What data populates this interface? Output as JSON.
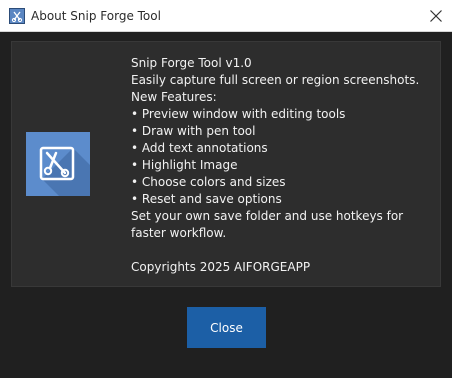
{
  "window": {
    "title": "About Snip Forge Tool"
  },
  "about": {
    "heading": "Snip Forge Tool v1.0",
    "description": "Easily capture full screen or region screenshots.",
    "features_label": "New Features:",
    "features": [
      "• Preview window with editing tools",
      "• Draw with pen tool",
      "• Add text annotations",
      "• Highlight Image",
      "• Choose colors and sizes",
      "• Reset and save options"
    ],
    "note": "Set your own save folder and use hotkeys for faster workflow.",
    "copyright": "Copyrights 2025 AIFORGEAPP"
  },
  "buttons": {
    "close_label": "Close"
  },
  "icons": {
    "app": "scissors-icon",
    "title_close": "close-icon",
    "logo": "scissors-logo-icon"
  },
  "colors": {
    "accent": "#1c5fa6",
    "background": "#202020",
    "panel": "#2d2d2d",
    "logo_background": "#5c8ccc"
  }
}
